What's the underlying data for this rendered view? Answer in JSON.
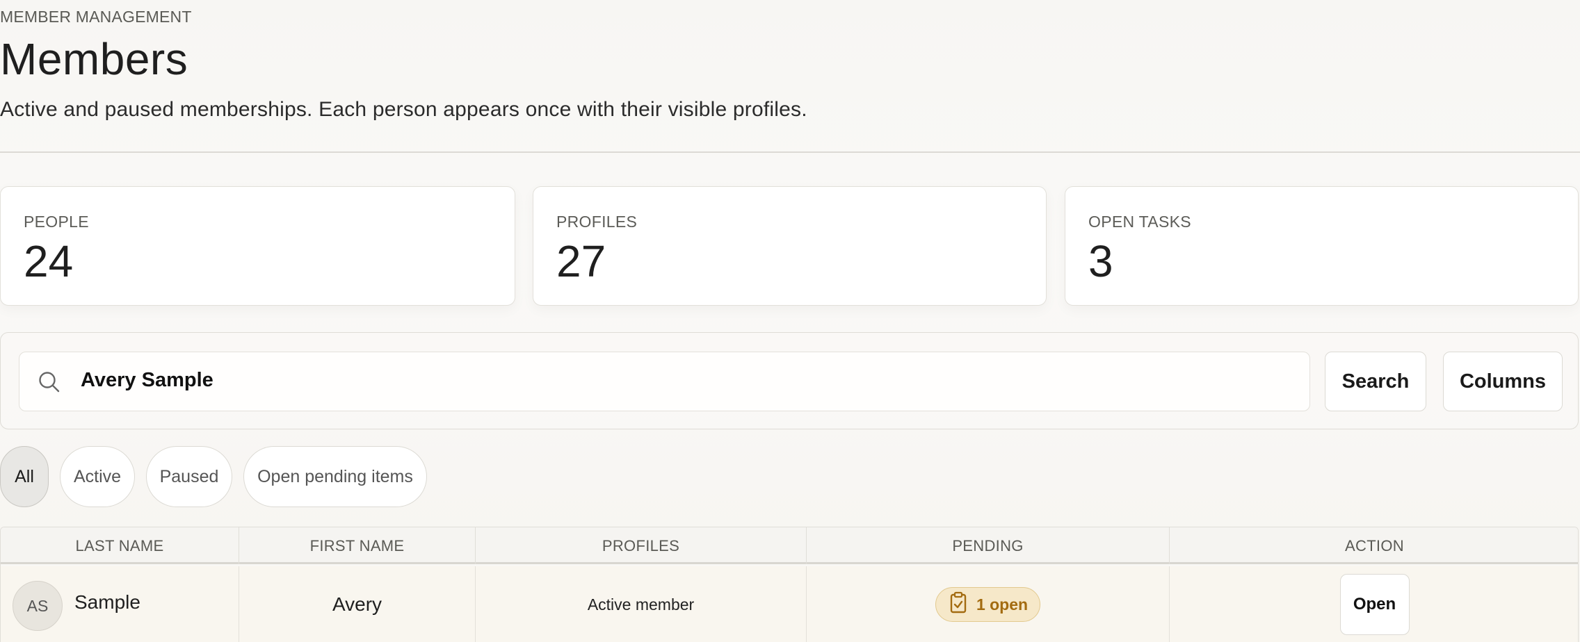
{
  "header": {
    "eyebrow": "MEMBER MANAGEMENT",
    "title": "Members",
    "subtitle": "Active and paused memberships. Each person appears once with their visible profiles."
  },
  "stats": [
    {
      "label": "PEOPLE",
      "value": "24"
    },
    {
      "label": "PROFILES",
      "value": "27"
    },
    {
      "label": "OPEN TASKS",
      "value": "3"
    }
  ],
  "search": {
    "icon": "search-icon",
    "value": "Avery Sample",
    "search_label": "Search",
    "columns_label": "Columns"
  },
  "filters": [
    {
      "label": "All",
      "active": true
    },
    {
      "label": "Active",
      "active": false
    },
    {
      "label": "Paused",
      "active": false
    },
    {
      "label": "Open pending items",
      "active": false
    }
  ],
  "table": {
    "columns": [
      "LAST NAME",
      "FIRST NAME",
      "PROFILES",
      "PENDING",
      "ACTION"
    ],
    "rows": [
      {
        "initials": "AS",
        "last_name": "Sample",
        "first_name": "Avery",
        "profiles": "Active member",
        "pending": "1 open",
        "pending_icon": "clipboard-check-icon",
        "action": "Open"
      }
    ]
  },
  "colors": {
    "accent_badge_bg": "#f6e8c9",
    "accent_badge_text": "#a36b10",
    "row_highlight": "#f9f6ef"
  }
}
